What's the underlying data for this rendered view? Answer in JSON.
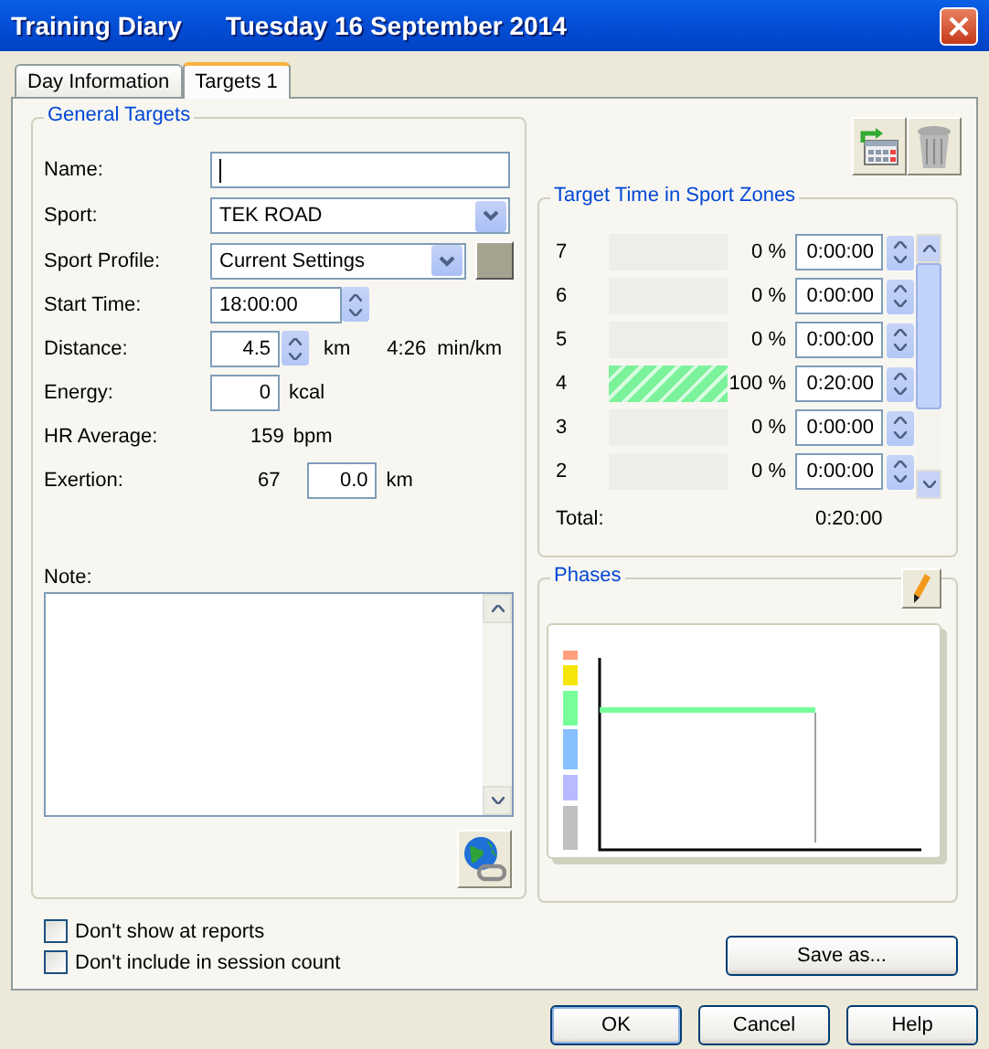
{
  "window": {
    "title": "Training Diary",
    "subtitle": "Tuesday 16 September 2014"
  },
  "tabs": [
    {
      "label": "Day Information",
      "selected": false
    },
    {
      "label": "Targets 1",
      "selected": true
    }
  ],
  "general_targets": {
    "title": "General Targets",
    "name": {
      "label": "Name:"
    },
    "sport": {
      "label": "Sport:",
      "value": "TEK ROAD"
    },
    "sport_profile": {
      "label": "Sport Profile:",
      "value": "Current Settings"
    },
    "start_time": {
      "label": "Start Time:",
      "value": "18:00:00"
    },
    "distance": {
      "label": "Distance:",
      "value": "4.5",
      "unit": "km",
      "pace": "4:26",
      "pace_unit": "min/km"
    },
    "energy": {
      "label": "Energy:",
      "value": "0",
      "unit": "kcal"
    },
    "hr_average": {
      "label": "HR Average:",
      "value": "159",
      "unit": "bpm"
    },
    "exertion": {
      "label": "Exertion:",
      "value": "67",
      "distance": "0.0",
      "unit": "km"
    },
    "note": {
      "label": "Note:"
    }
  },
  "zones": {
    "title": "Target Time in Sport Zones",
    "rows": [
      {
        "zone": "7",
        "level": 0,
        "percent": "0 %",
        "time": "0:00:00"
      },
      {
        "zone": "6",
        "level": 0,
        "percent": "0 %",
        "time": "0:00:00"
      },
      {
        "zone": "5",
        "level": 0,
        "percent": "0 %",
        "time": "0:00:00"
      },
      {
        "zone": "4",
        "level": 1,
        "percent": "100 %",
        "time": "0:20:00"
      },
      {
        "zone": "3",
        "level": 0,
        "percent": "0 %",
        "time": "0:00:00"
      },
      {
        "zone": "2",
        "level": 0,
        "percent": "0 %",
        "time": "0:00:00"
      }
    ],
    "total_label": "Total:",
    "total": "0:20:00"
  },
  "phases": {
    "title": "Phases"
  },
  "options": [
    {
      "label": "Don't show at reports",
      "checked": false
    },
    {
      "label": "Don't include in session count",
      "checked": false
    }
  ],
  "save_as": "Save as...",
  "buttons": [
    "OK",
    "Cancel",
    "Help"
  ]
}
